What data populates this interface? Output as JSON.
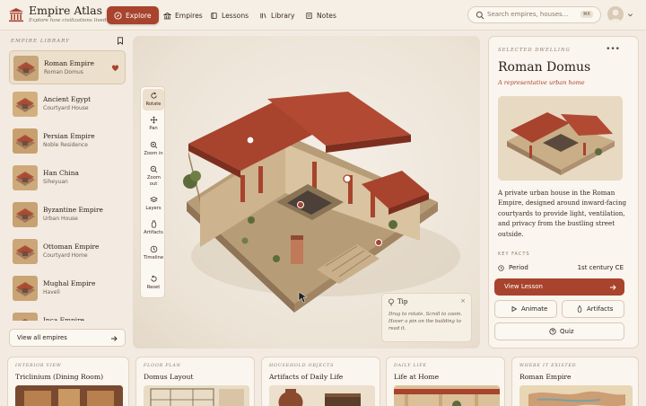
{
  "brand": {
    "title": "Empire Atlas",
    "subtitle": "Explore how civilizations lived"
  },
  "nav": [
    {
      "label": "Explore",
      "icon": "compass-icon"
    },
    {
      "label": "Empires",
      "icon": "landmark-icon"
    },
    {
      "label": "Lessons",
      "icon": "book-icon"
    },
    {
      "label": "Library",
      "icon": "library-icon"
    },
    {
      "label": "Notes",
      "icon": "notes-icon"
    }
  ],
  "search": {
    "placeholder": "Search empires, houses...",
    "shortcut": "⌘K"
  },
  "sidebar": {
    "heading": "EMPIRE LIBRARY",
    "items": [
      {
        "name": "Roman Empire",
        "house": "Roman Domus"
      },
      {
        "name": "Ancient Egypt",
        "house": "Courtyard House"
      },
      {
        "name": "Persian Empire",
        "house": "Noble Residence"
      },
      {
        "name": "Han China",
        "house": "Siheyuan"
      },
      {
        "name": "Byzantine Empire",
        "house": "Urban House"
      },
      {
        "name": "Ottoman Empire",
        "house": "Courtyard Home"
      },
      {
        "name": "Mughal Empire",
        "house": "Haveli"
      },
      {
        "name": "Inca Empire",
        "house": ""
      }
    ],
    "view_all": "View all empires"
  },
  "tools": [
    "Rotate",
    "Pan",
    "Zoom in",
    "Zoom out",
    "Layers",
    "Artifacts",
    "Timeline",
    "Reset"
  ],
  "tip": {
    "title": "Tip",
    "text": "Drag to rotate. Scroll to zoom. Hover a pin on the building to read it."
  },
  "detail": {
    "label": "SELECTED DWELLING",
    "title": "Roman Domus",
    "subtitle": "A representative urban home",
    "description": "A private urban house in the Roman Empire, designed around inward-facing courtyards to provide light, ventilation, and privacy from the bustling street outside.",
    "key_facts_label": "KEY FACTS",
    "facts": [
      {
        "key": "Period",
        "value": "1st century CE"
      }
    ],
    "lesson_button": "View Lesson",
    "animate_button": "Animate",
    "artifacts_button": "Artifacts",
    "quiz_button": "Quiz"
  },
  "cards": [
    {
      "label": "INTERIOR VIEW",
      "title": "Triclinium (Dining Room)"
    },
    {
      "label": "FLOOR PLAN",
      "title": "Domus Layout"
    },
    {
      "label": "HOUSEHOLD OBJECTS",
      "title": "Artifacts of Daily Life"
    },
    {
      "label": "DAILY LIFE",
      "title": "Life at Home"
    },
    {
      "label": "WHERE IT EXISTED",
      "title": "Roman Empire"
    }
  ],
  "colors": {
    "accent": "#a8432d",
    "background": "#f3ebe1",
    "panel": "#faf5ee",
    "roof": "#a8432d",
    "stone": "#d6c1a0"
  }
}
